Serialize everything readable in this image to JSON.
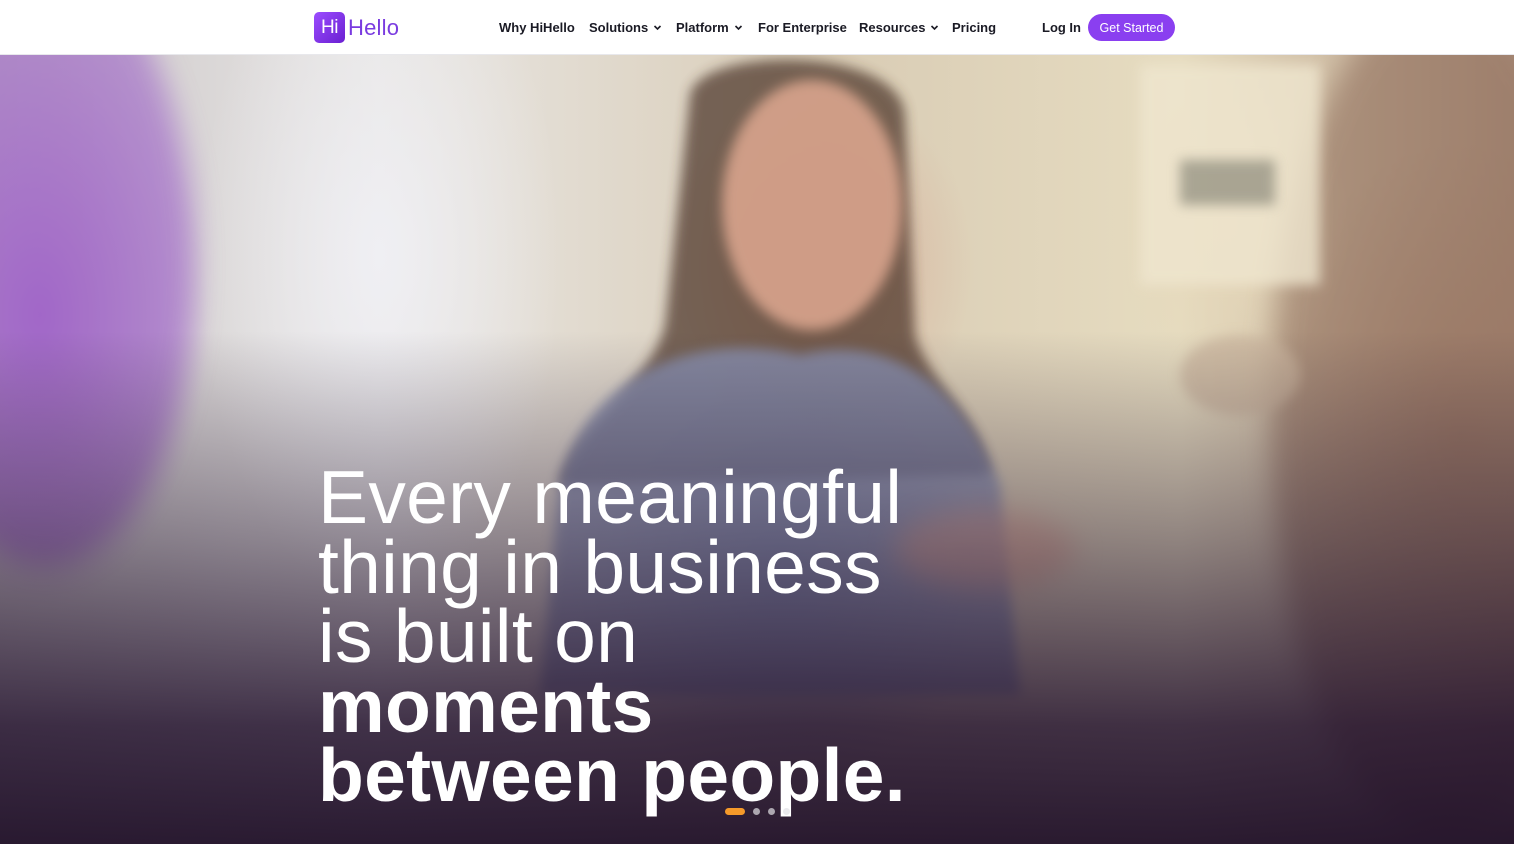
{
  "brand": {
    "badge": "Hi",
    "word": "Hello",
    "accent": "#8a3ff0"
  },
  "nav": {
    "items": [
      {
        "label": "Why HiHello",
        "has_dropdown": false
      },
      {
        "label": "Solutions",
        "has_dropdown": true
      },
      {
        "label": "Platform",
        "has_dropdown": true
      },
      {
        "label": "For Enterprise",
        "has_dropdown": false
      },
      {
        "label": "Resources",
        "has_dropdown": true
      },
      {
        "label": "Pricing",
        "has_dropdown": false
      }
    ],
    "login": "Log In",
    "cta": "Get Started"
  },
  "hero": {
    "headline_regular": "Every meaningful thing in business is built on",
    "headline_bold": "moments between people.",
    "carousel": {
      "slides": 4,
      "active_index": 0,
      "active_color": "#f59a2a"
    }
  }
}
